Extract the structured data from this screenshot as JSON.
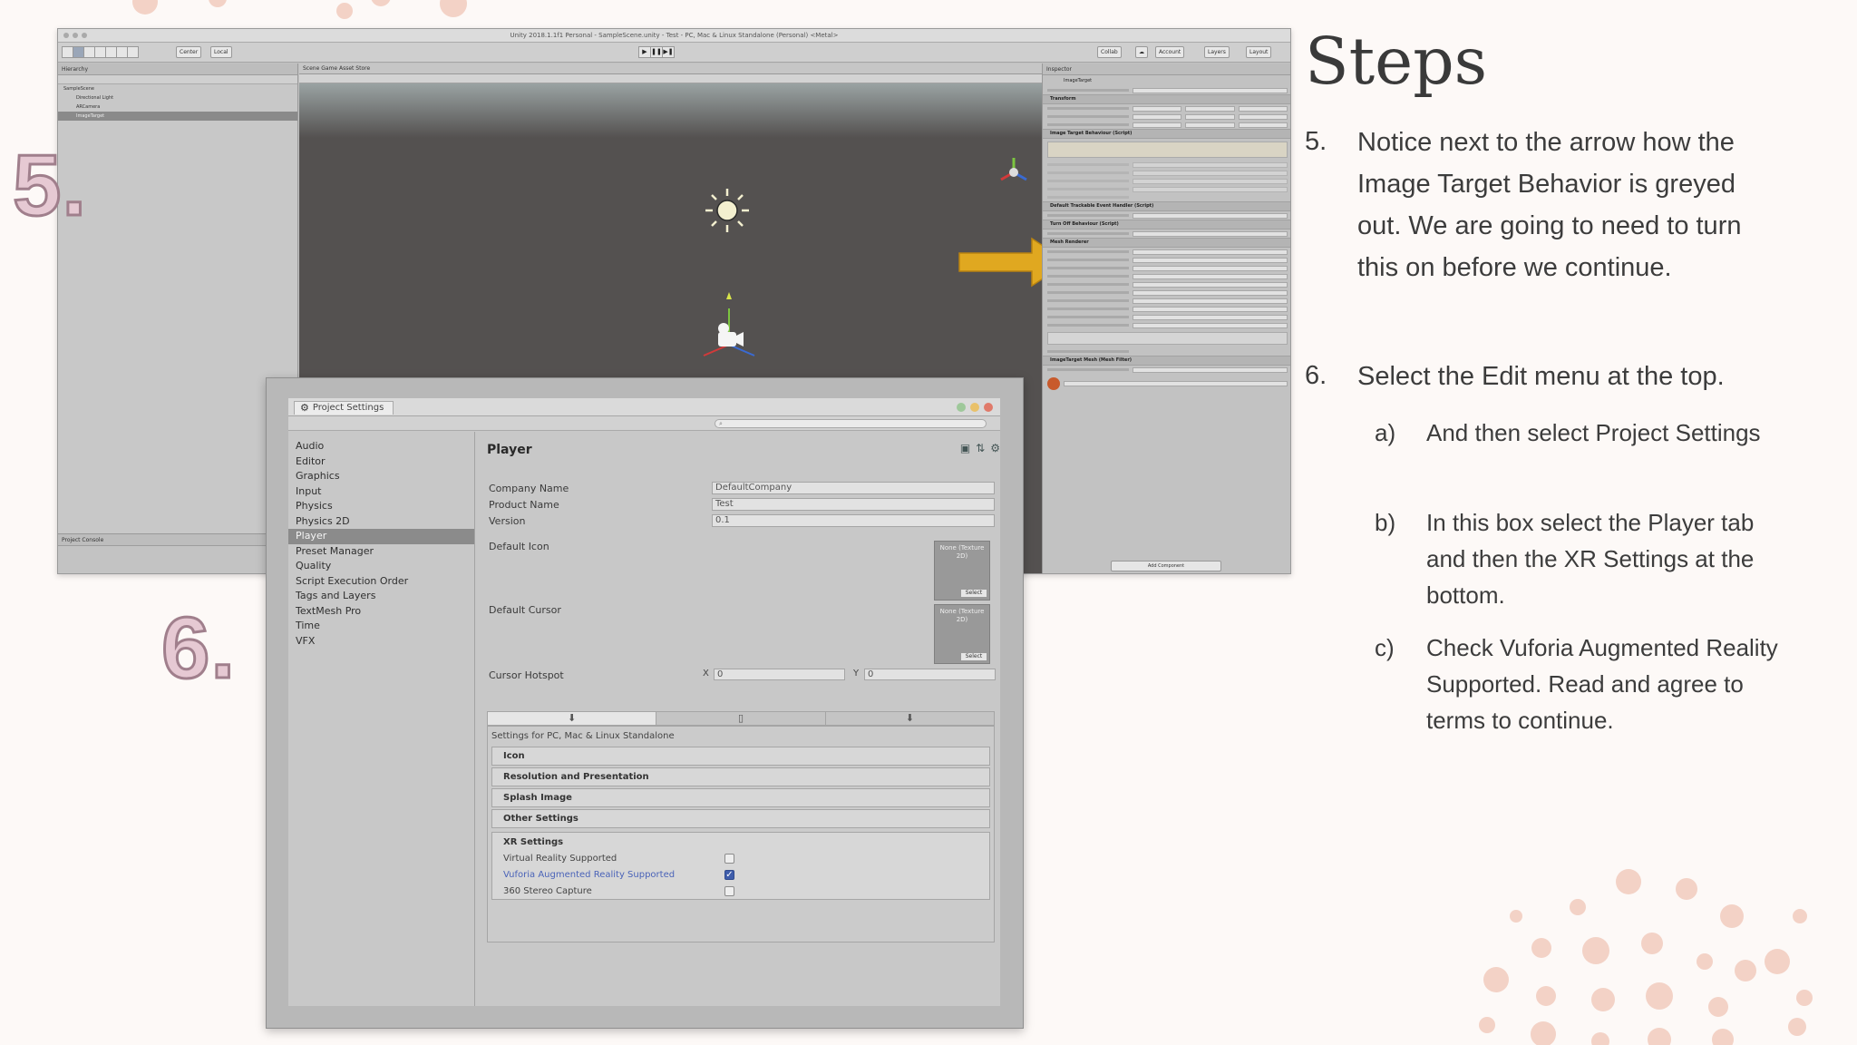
{
  "slide": {
    "title": "Steps",
    "step5_marker": "5.",
    "step6_marker": "6.",
    "steps": [
      {
        "num": "5.",
        "text": "Notice next to the arrow how the Image Target Behavior is greyed out. We are going to need to turn this on before we continue."
      },
      {
        "num": "6.",
        "text": "Select the Edit menu at the top."
      }
    ],
    "substeps": [
      {
        "num": "a)",
        "text": "And then select Project Settings"
      },
      {
        "num": "b)",
        "text": "In this box select the Player tab and then the XR Settings at the bottom."
      },
      {
        "num": "c)",
        "text": "Check Vuforia Augmented Reality Supported. Read and agree to terms to continue."
      }
    ],
    "colors": {
      "arrow": "#e0a820",
      "numeral_fill": "#e6c9d3",
      "numeral_stroke": "#a07f8c",
      "dots": "#f3d2c6"
    }
  },
  "unity": {
    "window_title": "Unity 2018.1.1f1 Personal - SampleScene.unity - Test - PC, Mac & Linux Standalone (Personal) <Metal>",
    "toolbar": {
      "center": "Center",
      "local": "Local",
      "collab": "Collab",
      "account": "Account",
      "layers": "Layers",
      "layout": "Layout"
    },
    "hierarchy": {
      "tab": "Hierarchy",
      "items": [
        "SampleScene",
        "Directional Light",
        "ARCamera",
        "ImageTarget"
      ]
    },
    "scene_tabs": "Scene   Game   Asset Store",
    "inspector": {
      "tab": "Inspector",
      "object_name": "ImageTarget",
      "components": [
        "Transform",
        "Image Target Behaviour (Script)",
        "Default Trackable Event Handler (Script)",
        "Turn Off Behaviour (Script)",
        "Mesh Renderer",
        "ImageTarget Mesh (Mesh Filter)"
      ],
      "add_component": "Add Component"
    },
    "project_tabs": "Project   Console"
  },
  "project_settings": {
    "tab_title": "Project Settings",
    "search_placeholder": "",
    "sidebar": [
      "Audio",
      "Editor",
      "Graphics",
      "Input",
      "Physics",
      "Physics 2D",
      "Player",
      "Preset Manager",
      "Quality",
      "Script Execution Order",
      "Tags and Layers",
      "TextMesh Pro",
      "Time",
      "VFX"
    ],
    "selected": "Player",
    "heading": "Player",
    "fields": [
      {
        "label": "Company Name",
        "value": "DefaultCompany"
      },
      {
        "label": "Product Name",
        "value": "Test"
      },
      {
        "label": "Version",
        "value": "0.1"
      }
    ],
    "default_icon": "Default Icon",
    "default_cursor": "Default Cursor",
    "texture_none": "None (Texture 2D)",
    "select": "Select",
    "cursor_hotspot": {
      "label": "Cursor Hotspot",
      "x_label": "X",
      "x": "0",
      "y_label": "Y",
      "y": "0"
    },
    "platform_settings": "Settings for PC, Mac & Linux Standalone",
    "sections": [
      "Icon",
      "Resolution and Presentation",
      "Splash Image",
      "Other Settings"
    ],
    "xr": {
      "title": "XR Settings",
      "options": [
        {
          "label": "Virtual Reality Supported",
          "checked": false
        },
        {
          "label": "Vuforia Augmented Reality Supported",
          "checked": true
        },
        {
          "label": "360 Stereo Capture",
          "checked": false
        }
      ]
    }
  }
}
